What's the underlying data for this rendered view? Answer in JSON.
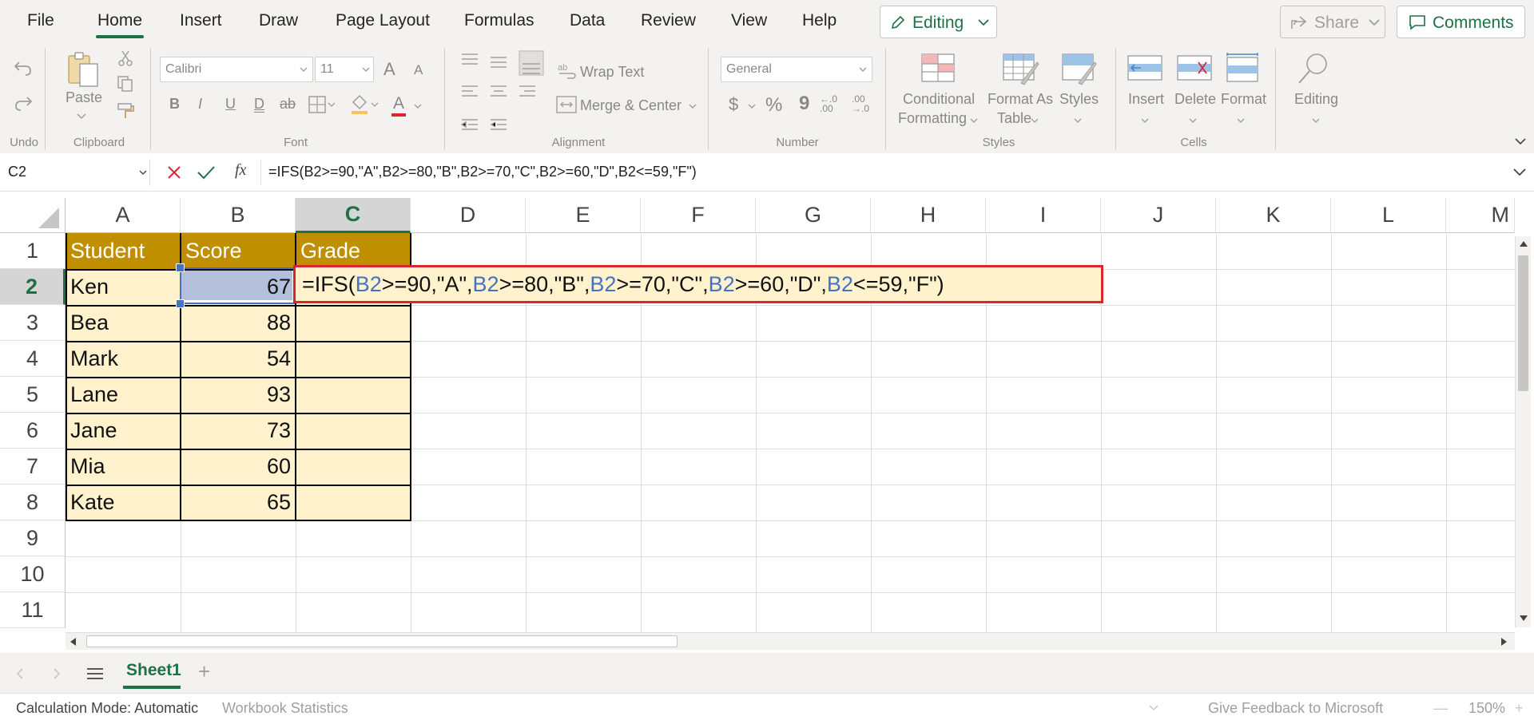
{
  "menu": {
    "tabs": [
      "File",
      "Home",
      "Insert",
      "Draw",
      "Page Layout",
      "Formulas",
      "Data",
      "Review",
      "View",
      "Help"
    ],
    "active_tab": "Home",
    "editing_label": "Editing",
    "share_label": "Share",
    "comments_label": "Comments"
  },
  "ribbon": {
    "undo_label": "Undo",
    "clipboard": {
      "label": "Clipboard",
      "paste": "Paste"
    },
    "font": {
      "label": "Font",
      "name": "Calibri",
      "size": "11",
      "bold": "B",
      "italic": "I",
      "underline": "U",
      "double_underline": "D",
      "strike": "ab",
      "grow": "A",
      "shrink": "A",
      "color": "A"
    },
    "alignment": {
      "label": "Alignment",
      "wrap_text": "Wrap Text",
      "merge_center": "Merge & Center"
    },
    "number": {
      "label": "Number",
      "format": "General",
      "currency": "$",
      "percent": "%",
      "comma": "9",
      "inc_decimal": "←.0 .00",
      "dec_decimal": ".00 →.0"
    },
    "styles": {
      "label": "Styles",
      "conditional_1": "Conditional",
      "conditional_2": "Formatting",
      "format_table_1": "Format As",
      "format_table_2": "Table",
      "styles": "Styles"
    },
    "cells": {
      "label": "Cells",
      "insert": "Insert",
      "delete": "Delete",
      "format": "Format"
    },
    "editing": {
      "label": "Editing"
    }
  },
  "formula_bar": {
    "name_box": "C2",
    "fx": "fx",
    "formula": "=IFS(B2>=90,\"A\",B2>=80,\"B\",B2>=70,\"C\",B2>=60,\"D\",B2<=59,\"F\")"
  },
  "grid": {
    "columns": [
      "A",
      "B",
      "C",
      "D",
      "E",
      "F",
      "G",
      "H",
      "I",
      "J",
      "K",
      "L",
      "M"
    ],
    "rows": [
      "1",
      "2",
      "3",
      "4",
      "5",
      "6",
      "7",
      "8",
      "9",
      "10",
      "11"
    ],
    "selected_column": "C",
    "selected_row": "2",
    "headers": [
      "Student",
      "Score",
      "Grade"
    ],
    "students": [
      {
        "name": "Ken",
        "score": "67"
      },
      {
        "name": "Bea",
        "score": "88"
      },
      {
        "name": "Mark",
        "score": "54"
      },
      {
        "name": "Lane",
        "score": "93"
      },
      {
        "name": "Jane",
        "score": "73"
      },
      {
        "name": "Mia",
        "score": "60"
      },
      {
        "name": "Kate",
        "score": "65"
      }
    ],
    "edit_formula_parts": [
      "=IFS(",
      "B2",
      ">=90,\"A\",",
      "B2",
      ">=80,\"B\",",
      "B2",
      ">=70,\"C\",",
      "B2",
      ">=60,\"D\",",
      "B2",
      "<=59,\"F\")"
    ]
  },
  "sheets": {
    "tabs": [
      "Sheet1"
    ],
    "add": "+"
  },
  "status": {
    "calc_mode": "Calculation Mode: Automatic",
    "workbook_stats": "Workbook Statistics",
    "feedback": "Give Feedback to Microsoft",
    "zoom": "150%",
    "zoom_minus": "—",
    "zoom_plus": "+"
  },
  "colors": {
    "accent": "#1e7145",
    "header_fill": "#bf8f00",
    "body_fill": "#fff2cc",
    "highlight_border": "#d9252e",
    "reference": "#4472c4"
  }
}
